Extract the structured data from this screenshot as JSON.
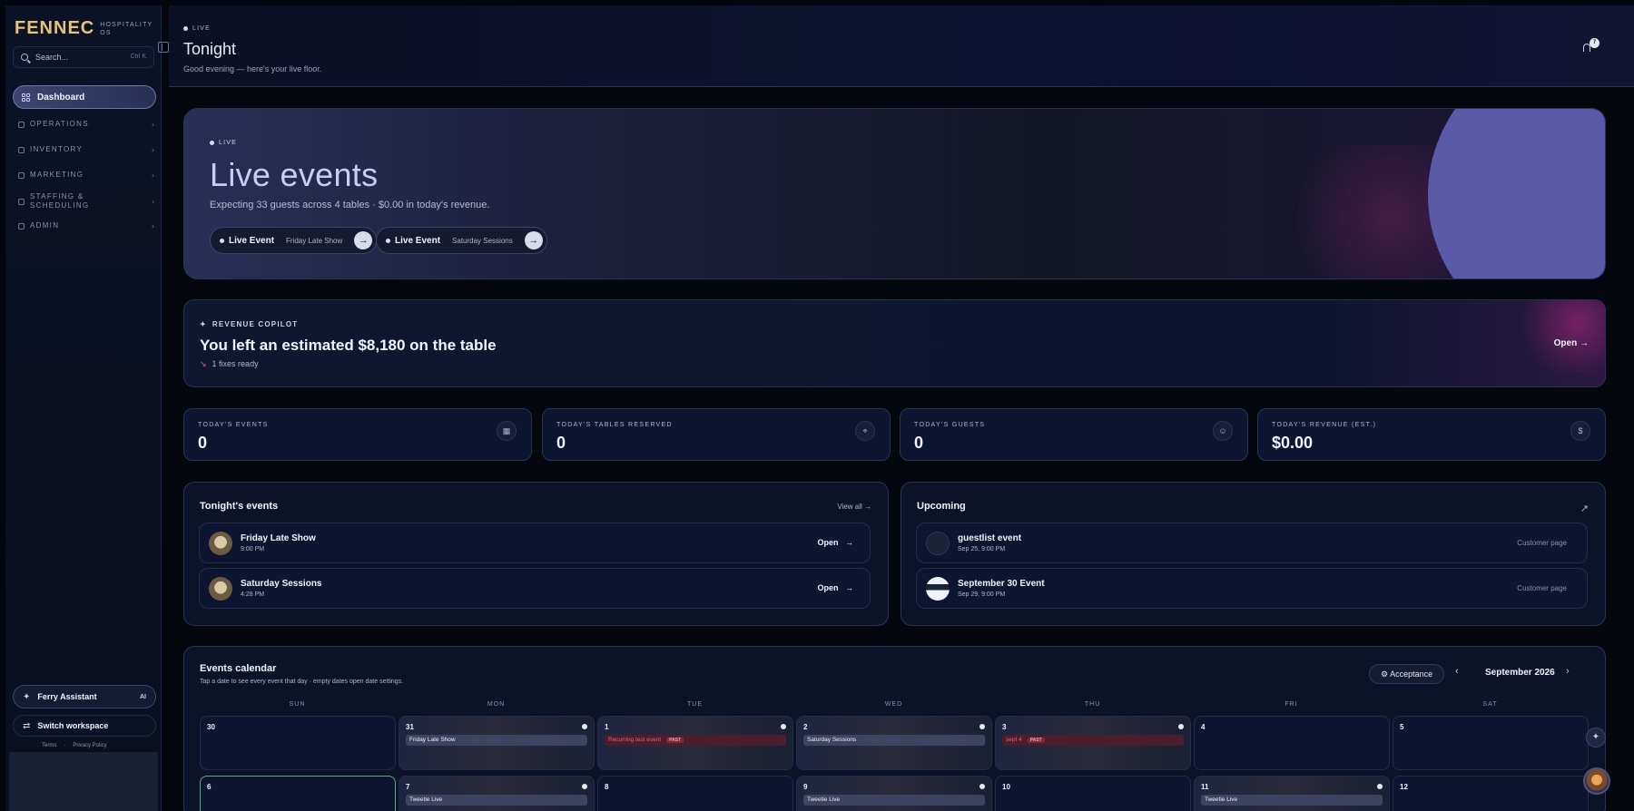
{
  "brand": {
    "name": "FENNEC",
    "subtitle": "HOSPITALITY OS"
  },
  "search": {
    "placeholder": "Search...",
    "shortcut": "Ctrl K"
  },
  "sidebar": {
    "active": "Dashboard",
    "sections": [
      "OPERATIONS",
      "INVENTORY",
      "MARKETING",
      "STAFFING & SCHEDULING",
      "ADMIN"
    ],
    "assistant": {
      "label": "Ferry Assistant",
      "badge": "AI"
    },
    "switch": "Switch workspace",
    "links": [
      "Terms",
      "Privacy Policy"
    ]
  },
  "header": {
    "live": "LIVE",
    "title": "Tonight",
    "subtitle": "Good evening — here's your live floor.",
    "notifications": "7"
  },
  "hero": {
    "live": "LIVE",
    "title": "Live events",
    "subtitle": "Expecting 33 guests across 4 tables · $0.00 in today's revenue.",
    "pills": [
      {
        "label": "Live Event",
        "name": "Friday Late Show"
      },
      {
        "label": "Live Event",
        "name": "Saturday Sessions"
      }
    ]
  },
  "copilot": {
    "label": "REVENUE COPILOT",
    "title": "You left an estimated $8,180 on the table",
    "fixes": "1 fixes ready",
    "open": "Open"
  },
  "stats": [
    {
      "label": "TODAY'S EVENTS",
      "value": "0",
      "icon": "calendar-icon"
    },
    {
      "label": "TODAY'S TABLES RESERVED",
      "value": "0",
      "icon": "pin-icon"
    },
    {
      "label": "TODAY'S GUESTS",
      "value": "0",
      "icon": "users-icon"
    },
    {
      "label": "TODAY'S REVENUE (EST.)",
      "value": "$0.00",
      "icon": "dollar-icon"
    }
  ],
  "tonight": {
    "title": "Tonight's events",
    "view_all": "View all",
    "items": [
      {
        "name": "Friday Late Show",
        "time": "9:00 PM",
        "action": "Open"
      },
      {
        "name": "Saturday Sessions",
        "time": "4:28 PM",
        "action": "Open"
      }
    ]
  },
  "upcoming": {
    "title": "Upcoming",
    "items": [
      {
        "name": "guestlist event",
        "time": "Sep 25, 9:00 PM",
        "action": "Customer page"
      },
      {
        "name": "September 30 Event",
        "time": "Sep 29, 9:00 PM",
        "action": "Customer page"
      }
    ]
  },
  "calendar": {
    "title": "Events calendar",
    "subtitle": "Tap a date to see every event that day · empty dates open date settings.",
    "filter": "Acceptance",
    "month": "September 2026",
    "days": [
      "SUN",
      "MON",
      "TUE",
      "WED",
      "THU",
      "FRI",
      "SAT"
    ],
    "week1": [
      {
        "d": "30",
        "tag": ""
      },
      {
        "d": "31",
        "tag": "Friday Late Show",
        "dot": true
      },
      {
        "d": "1",
        "tag": "Recurring test event",
        "past": "PAST",
        "dot": true
      },
      {
        "d": "2",
        "tag": "Saturday Sessions",
        "dot": true
      },
      {
        "d": "3",
        "tag": "sept 4",
        "past": "PAST",
        "dot": true
      },
      {
        "d": "4",
        "tag": ""
      },
      {
        "d": "5",
        "tag": ""
      }
    ],
    "week2": [
      {
        "d": "6",
        "tag": ""
      },
      {
        "d": "7",
        "tag": "Tweetie Live",
        "dot": true
      },
      {
        "d": "8",
        "tag": ""
      },
      {
        "d": "9",
        "tag": "Tweetie Live",
        "dot": true
      },
      {
        "d": "10",
        "tag": ""
      },
      {
        "d": "11",
        "tag": "Tweetie Live",
        "dot": true
      },
      {
        "d": "12",
        "tag": ""
      }
    ]
  }
}
